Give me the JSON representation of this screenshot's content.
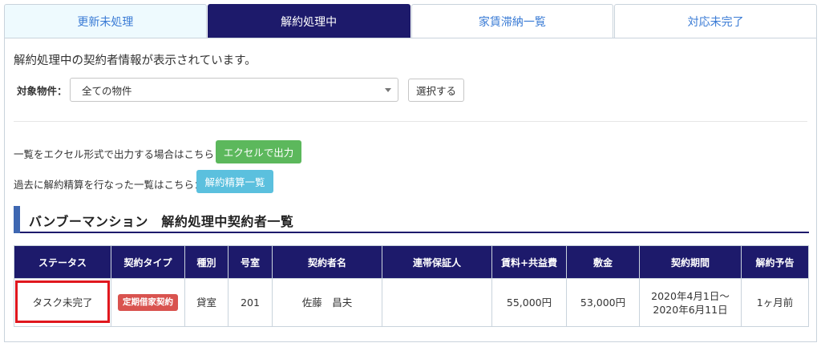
{
  "tabs": [
    {
      "label": "更新未処理"
    },
    {
      "label": "解約処理中"
    },
    {
      "label": "家賃滞納一覧"
    },
    {
      "label": "対応未完了"
    }
  ],
  "active_tab_index": 1,
  "description": "解約処理中の契約者情報が表示されています。",
  "filter": {
    "label": "対象物件：",
    "selected": "全ての物件",
    "select_button": "選択する"
  },
  "export": {
    "text": "一覧をエクセル形式で出力する場合はこちら：",
    "button": "エクセルで出力"
  },
  "past": {
    "text": "過去に解約精算を行なった一覧はこちら：",
    "button": "解約精算一覧"
  },
  "section_title": "バンブーマンション　解約処理中契約者一覧",
  "table": {
    "headers": [
      "ステータス",
      "契約タイプ",
      "種別",
      "号室",
      "契約者名",
      "連帯保証人",
      "賃料+共益費",
      "敷金",
      "契約期間",
      "解約予告"
    ],
    "rows": [
      {
        "status": "タスク未完了",
        "contract_type": "定期借家契約",
        "kind": "貸室",
        "room": "201",
        "name": "佐藤　昌夫",
        "guarantor": "",
        "rent": "55,000円",
        "deposit": "53,000円",
        "period_start": "2020年4月1日～",
        "period_end": "2020年6月11日",
        "notice": "1ヶ月前"
      }
    ]
  },
  "colors": {
    "header_navy": "#1d1a6b",
    "excel_green": "#5cb85c",
    "info_blue": "#5bc0de",
    "badge_red": "#d9534f",
    "highlight_red": "#e0171e"
  }
}
